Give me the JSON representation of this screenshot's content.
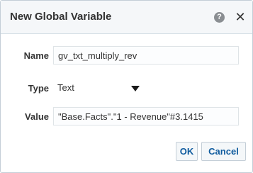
{
  "dialog": {
    "title": "New Global Variable",
    "help_icon_glyph": "?",
    "close_icon_glyph": "✕",
    "icons": [
      "help-icon",
      "close-icon",
      "caret-down-icon"
    ]
  },
  "form": {
    "name_label": "Name",
    "name_value": "gv_txt_multiply_rev",
    "type_label": "Type",
    "type_value": "Text",
    "value_label": "Value",
    "value_value": "\"Base.Facts\".\"1 - Revenue\"#3.1415"
  },
  "buttons": {
    "ok_label": "OK",
    "cancel_label": "Cancel"
  },
  "colors": {
    "button_text": "#0f5b9e",
    "title_bar": "#f5f7f9",
    "border": "#c4ced7"
  }
}
